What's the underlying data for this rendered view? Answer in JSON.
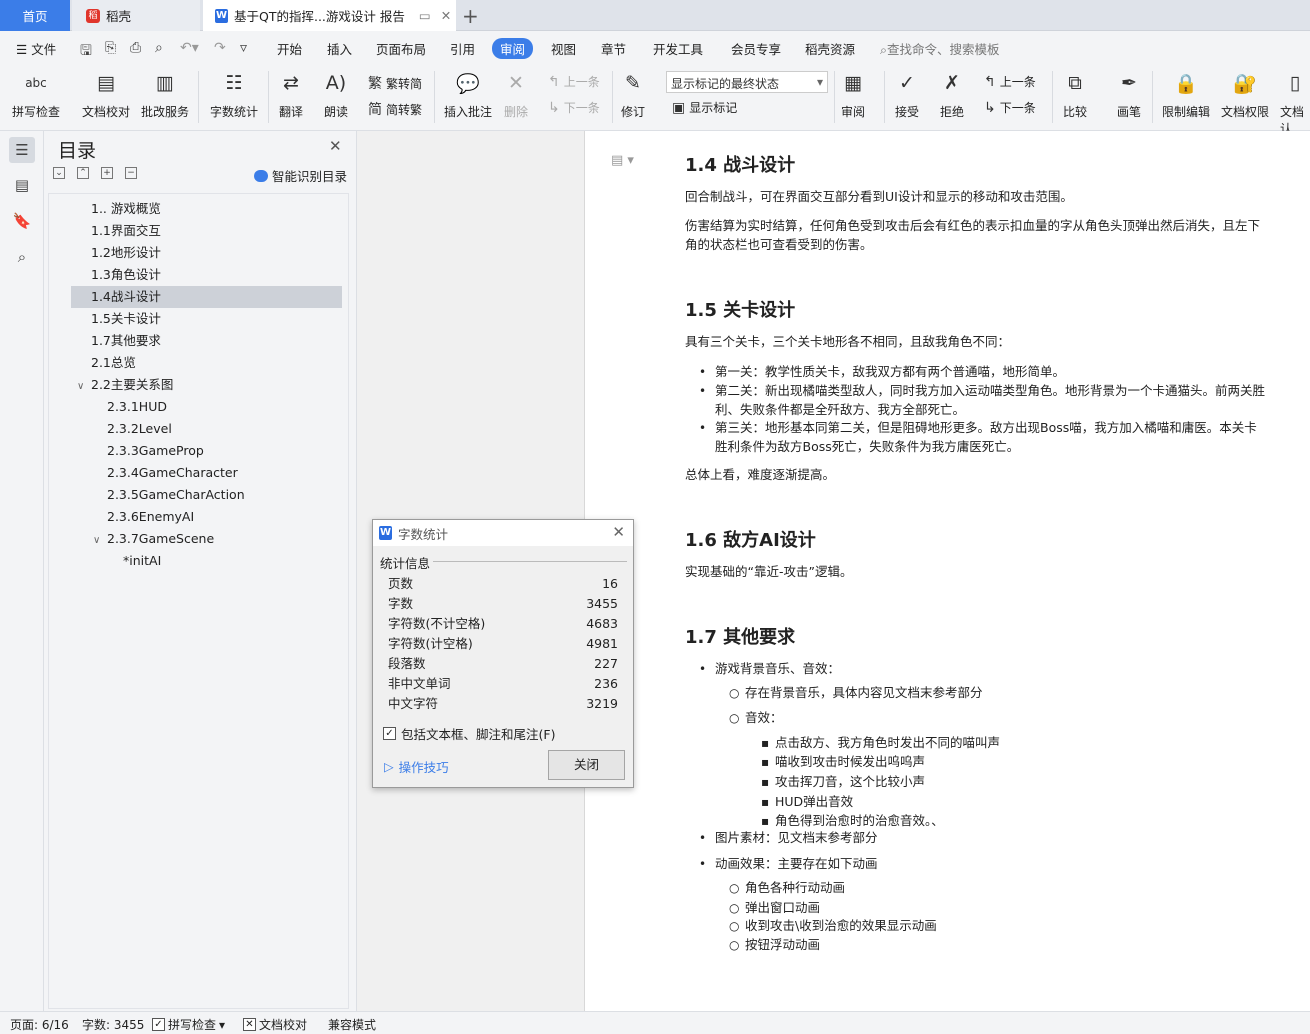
{
  "tabs": {
    "home": "首页",
    "daoke": "稻壳",
    "doc": "基于QT的指挥...游戏设计 报告"
  },
  "menubar": {
    "file": "文件",
    "items": [
      "开始",
      "插入",
      "页面布局",
      "引用",
      "审阅",
      "视图",
      "章节",
      "开发工具",
      "会员专享",
      "稻壳资源"
    ],
    "search_placeholder": "查找命令、搜索模板"
  },
  "ribbon": {
    "spell": "拼写检查",
    "proof": "文档校对",
    "revise_service": "批改服务",
    "word_count": "字数统计",
    "translate": "翻译",
    "read_aloud": "朗读",
    "to_traditional": "繁转简",
    "to_simplified": "简转繁",
    "insert_comment": "插入批注",
    "delete": "删除",
    "prev": "上一条",
    "next": "下一条",
    "revise": "修订",
    "mark_state": "显示标记的最终状态",
    "show_marks": "显示标记",
    "review": "审阅",
    "accept": "接受",
    "reject": "拒绝",
    "prev2": "上一条",
    "next2": "下一条",
    "compare": "比较",
    "pen": "画笔",
    "restrict_edit": "限制编辑",
    "doc_rights": "文档权限",
    "doc_more": "文档认"
  },
  "toc": {
    "title": "目录",
    "smart": "智能识别目录",
    "items": [
      {
        "label": "1.. 游戏概览"
      },
      {
        "label": "1.1界面交互"
      },
      {
        "label": "1.2地形设计"
      },
      {
        "label": "1.3角色设计"
      },
      {
        "label": "1.4战斗设计"
      },
      {
        "label": "1.5关卡设计"
      },
      {
        "label": "1.7其他要求"
      },
      {
        "label": "2.1总览"
      },
      {
        "label": "2.2主要关系图"
      },
      {
        "label": "2.3.1HUD"
      },
      {
        "label": "2.3.2Level"
      },
      {
        "label": "2.3.3GameProp"
      },
      {
        "label": "2.3.4GameCharacter"
      },
      {
        "label": "2.3.5GameCharAction"
      },
      {
        "label": "2.3.6EnemyAI"
      },
      {
        "label": "2.3.7GameScene"
      },
      {
        "label": "*initAI"
      }
    ]
  },
  "doc": {
    "h14": "1.4  战斗设计",
    "p14a": "回合制战斗，可在界面交互部分看到UI设计和显示的移动和攻击范围。",
    "p14b": "伤害结算为实时结算，任何角色受到攻击后会有红色的表示扣血量的字从角色头顶弹出然后消失，且左下角的状态栏也可查看受到的伤害。",
    "h15": "1.5  关卡设计",
    "p15a": "具有三个关卡，三个关卡地形各不相同，且敌我角色不同：",
    "l15": [
      "第一关：教学性质关卡，敌我双方都有两个普通喵，地形简单。",
      "第二关：新出现橘喵类型敌人，同时我方加入运动喵类型角色。地形背景为一个卡通猫头。前两关胜利、失败条件都是全歼敌方、我方全部死亡。",
      "第三关：地形基本同第二关，但是阻碍地形更多。敌方出现Boss喵，我方加入橘喵和庸医。本关卡胜利条件为敌方Boss死亡，失败条件为我方庸医死亡。"
    ],
    "p15b": "总体上看，难度逐渐提高。",
    "h16": "1.6  敌方AI设计",
    "p16": "实现基础的“靠近-攻击”逻辑。",
    "h17": "1.7  其他要求",
    "l17a": "游戏背景音乐、音效：",
    "l17a1": "存在背景音乐，具体内容见文档末参考部分",
    "l17a2": "音效：",
    "l17a2s": [
      "点击敌方、我方角色时发出不同的喵叫声",
      "喵收到攻击时候发出呜呜声",
      "攻击挥刀音，这个比较小声",
      "HUD弹出音效",
      "角色得到治愈时的治愈音效。、"
    ],
    "l17b": "图片素材：见文档末参考部分",
    "l17c": "动画效果：主要存在如下动画",
    "l17cs": [
      "角色各种行动动画",
      "弹出窗口动画",
      "收到攻击\\收到治愈的效果显示动画",
      "按钮浮动动画"
    ]
  },
  "dialog": {
    "title": "字数统计",
    "section": "统计信息",
    "rows": [
      {
        "k": "页数",
        "v": "16"
      },
      {
        "k": "字数",
        "v": "3455"
      },
      {
        "k": "字符数(不计空格)",
        "v": "4683"
      },
      {
        "k": "字符数(计空格)",
        "v": "4981"
      },
      {
        "k": "段落数",
        "v": "227"
      },
      {
        "k": "非中文单词",
        "v": "236"
      },
      {
        "k": "中文字符",
        "v": "3219"
      }
    ],
    "include": "包括文本框、脚注和尾注(F)",
    "tips": "操作技巧",
    "close": "关闭"
  },
  "status": {
    "page": "页面: 6/16",
    "words": "字数: 3455",
    "spell": "拼写检查",
    "proof": "文档校对",
    "compat": "兼容模式"
  },
  "colors": {
    "accent": "#3b7de8"
  }
}
